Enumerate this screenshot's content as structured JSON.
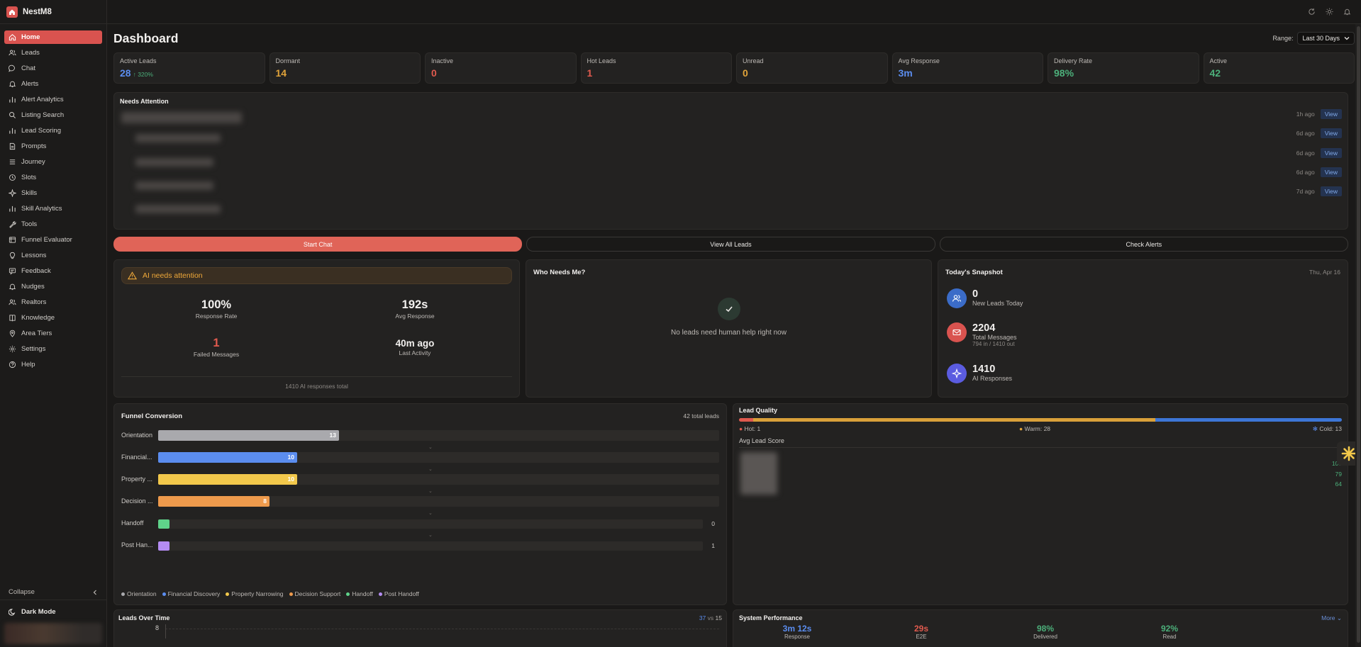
{
  "app": {
    "name": "NestM8"
  },
  "sidebar": {
    "items": [
      {
        "label": "Home",
        "icon": "home-icon"
      },
      {
        "label": "Leads",
        "icon": "users-icon"
      },
      {
        "label": "Chat",
        "icon": "chat-icon"
      },
      {
        "label": "Alerts",
        "icon": "bell-icon"
      },
      {
        "label": "Alert Analytics",
        "icon": "bar-chart-icon"
      },
      {
        "label": "Listing Search",
        "icon": "search-icon"
      },
      {
        "label": "Lead Scoring",
        "icon": "bar-chart-icon"
      },
      {
        "label": "Prompts",
        "icon": "document-icon"
      },
      {
        "label": "Journey",
        "icon": "list-icon"
      },
      {
        "label": "Slots",
        "icon": "clock-icon"
      },
      {
        "label": "Skills",
        "icon": "sparkle-icon"
      },
      {
        "label": "Skill Analytics",
        "icon": "bar-chart-icon"
      },
      {
        "label": "Tools",
        "icon": "wrench-icon"
      },
      {
        "label": "Funnel Evaluator",
        "icon": "funnel-icon"
      },
      {
        "label": "Lessons",
        "icon": "bulb-icon"
      },
      {
        "label": "Feedback",
        "icon": "message-icon"
      },
      {
        "label": "Nudges",
        "icon": "bell-icon"
      },
      {
        "label": "Realtors",
        "icon": "users-icon"
      },
      {
        "label": "Knowledge",
        "icon": "book-icon"
      },
      {
        "label": "Area Tiers",
        "icon": "pin-icon"
      },
      {
        "label": "Settings",
        "icon": "gear-icon"
      },
      {
        "label": "Help",
        "icon": "help-icon"
      }
    ],
    "collapse_label": "Collapse",
    "dark_mode_label": "Dark Mode"
  },
  "header": {
    "title": "Dashboard",
    "range_label": "Range:",
    "range_value": "Last 30 Days"
  },
  "stats": [
    {
      "label": "Active Leads",
      "value": "28",
      "sub": "↑ 320%",
      "color": "#5b8def"
    },
    {
      "label": "Dormant",
      "value": "14",
      "color": "#e0a33a"
    },
    {
      "label": "Inactive",
      "value": "0",
      "color": "#e05a4e"
    },
    {
      "label": "Hot Leads",
      "value": "1",
      "color": "#e05a4e"
    },
    {
      "label": "Unread",
      "value": "0",
      "color": "#e0a33a"
    },
    {
      "label": "Avg Response",
      "value": "3m",
      "color": "#5b8def"
    },
    {
      "label": "Delivery Rate",
      "value": "98%",
      "color": "#4caf7a"
    },
    {
      "label": "Active",
      "value": "42",
      "color": "#4caf7a"
    }
  ],
  "needs_attention": {
    "title": "Needs Attention",
    "rows": [
      {
        "time": "1h ago",
        "action": "View"
      },
      {
        "time": "6d ago",
        "action": "View"
      },
      {
        "time": "6d ago",
        "action": "View"
      },
      {
        "time": "6d ago",
        "action": "View"
      },
      {
        "time": "7d ago",
        "action": "View"
      }
    ]
  },
  "actions": {
    "start_chat": "Start Chat",
    "view_all_leads": "View All Leads",
    "check_alerts": "Check Alerts"
  },
  "ai": {
    "alert": "AI needs attention",
    "response_rate": {
      "value": "100%",
      "label": "Response Rate"
    },
    "avg_response": {
      "value": "192s",
      "label": "Avg Response"
    },
    "failed": {
      "value": "1",
      "label": "Failed Messages"
    },
    "last_activity": {
      "value": "40m ago",
      "label": "Last Activity"
    },
    "footer": "1410 AI responses total"
  },
  "who": {
    "title": "Who Needs Me?",
    "empty": "No leads need human help right now"
  },
  "snapshot": {
    "title": "Today's Snapshot",
    "date": "Thu, Apr 16",
    "new_leads": {
      "value": "0",
      "label": "New Leads Today"
    },
    "total_messages": {
      "value": "2204",
      "label": "Total Messages",
      "sub": "794 in / 1410 out"
    },
    "ai_responses": {
      "value": "1410",
      "label": "AI Responses"
    }
  },
  "funnel": {
    "title": "Funnel Conversion",
    "total": "42 total leads",
    "max": 42,
    "stages": [
      {
        "label": "Orientation",
        "value": 13,
        "display": "13",
        "color": "#a9a9ad"
      },
      {
        "label": "Financial...",
        "value": 10,
        "display": "10",
        "color": "#5b8def"
      },
      {
        "label": "Property ...",
        "value": 10,
        "display": "10",
        "color": "#f2c84b"
      },
      {
        "label": "Decision ...",
        "value": 8,
        "display": "8",
        "color": "#ee9a4c"
      },
      {
        "label": "Handoff",
        "value": 0,
        "display": "0",
        "color": "#5fd38a"
      },
      {
        "label": "Post Han...",
        "value": 1,
        "display": "1",
        "color": "#b48cf2"
      }
    ],
    "legend": [
      "Orientation",
      "Financial Discovery",
      "Property Narrowing",
      "Decision Support",
      "Handoff",
      "Post Handoff"
    ]
  },
  "lead_quality": {
    "title": "Lead Quality",
    "hot": "Hot: 1",
    "warm": "Warm: 28",
    "cold": "Cold: 13",
    "hot_n": 1,
    "warm_n": 28,
    "cold_n": 13,
    "avg_label": "Avg Lead Score",
    "scores": [
      "100",
      "79",
      "64"
    ]
  },
  "leads_over_time": {
    "title": "Leads Over Time",
    "current": "37",
    "vs": "vs",
    "previous": "15",
    "y_tick": "8"
  },
  "system_performance": {
    "title": "System Performance",
    "more": "More",
    "metrics": [
      {
        "value": "3m 12s",
        "label": "Response",
        "color": "#5b8def"
      },
      {
        "value": "29s",
        "label": "E2E",
        "color": "#e05a4e"
      },
      {
        "value": "98%",
        "label": "Delivered",
        "color": "#4caf7a"
      },
      {
        "value": "92%",
        "label": "Read",
        "color": "#4caf7a"
      }
    ]
  }
}
